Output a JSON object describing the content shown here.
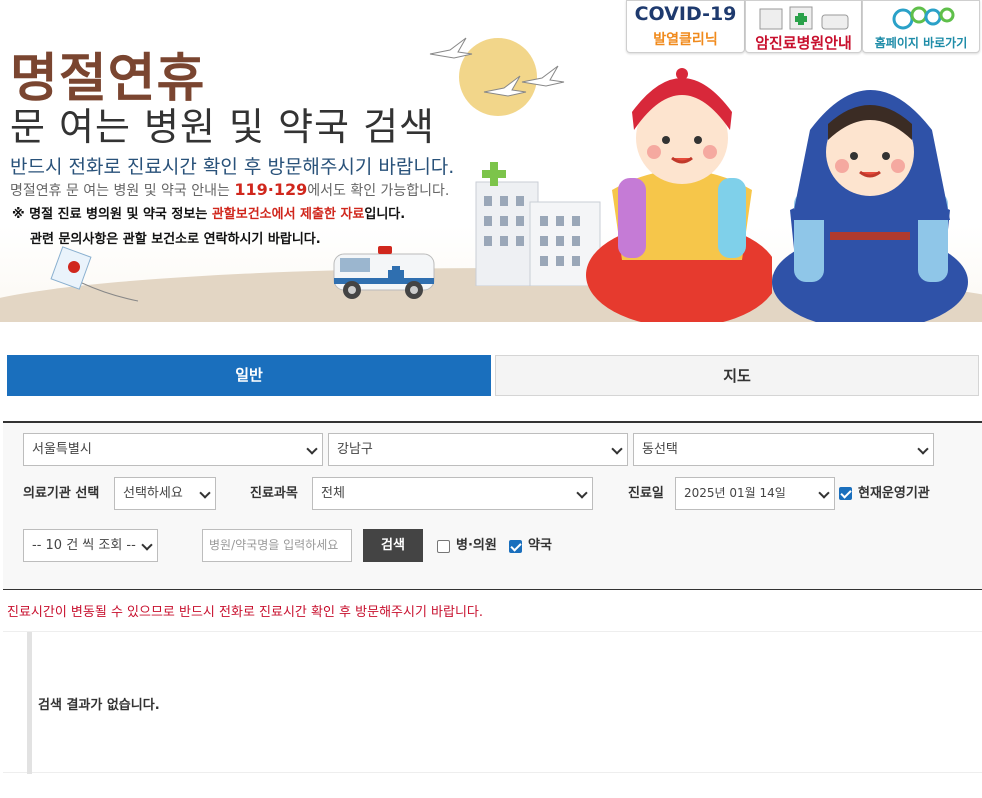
{
  "banner": {
    "title_line1": "명절연휴",
    "title_line2": "문 여는 병원 및 약국 검색",
    "subtitle": "반드시 전화로 진료시간 확인 후 방문해주시기 바랍니다.",
    "info_prefix": "명절연휴 문 여는 병원 및 약국 안내는 ",
    "info_numbers": "119·129",
    "info_suffix": "에서도 확인 가능합니다.",
    "note_prefix": "※ 명절 진료 병의원 및 약국 정보는 ",
    "note_highlight": "관할보건소에서 제출한 자료",
    "note_suffix": "입니다.",
    "contact": "관련 문의사항은 관할 보건소로 연락하시기 바랍니다."
  },
  "quick_links": {
    "covid_title": "COVID-19",
    "covid_sub": "발열클리닉",
    "cancer": "암진료병원안내",
    "homepage": "홈페이지 바로가기"
  },
  "tabs": [
    {
      "label": "일반",
      "active": true
    },
    {
      "label": "지도",
      "active": false
    }
  ],
  "filters": {
    "city": "서울특별시",
    "district": "강남구",
    "dong": "동선택",
    "institution_label": "의료기관 선택",
    "institution_value": "선택하세요",
    "department_label": "진료과목",
    "department_value": "전체",
    "date_label": "진료일",
    "date_value": "2025년 01월 14일",
    "open_now_label": "현재운영기관",
    "open_now_checked": true,
    "page_size": "-- 10 건 씩 조회 --",
    "search_placeholder": "병원/약국명을 입력하세요",
    "search_button": "검색",
    "hospital_label": "병·의원",
    "hospital_checked": false,
    "pharmacy_label": "약국",
    "pharmacy_checked": true
  },
  "notice": "진료시간이 변동될 수 있으므로 반드시 전화로 진료시간 확인 후 방문해주시기 바랍니다.",
  "result_message": "검색 결과가 없습니다.",
  "colors": {
    "primary": "#1a6fbd",
    "title_brown": "#7a4530",
    "highlight_red": "#d0271d"
  }
}
